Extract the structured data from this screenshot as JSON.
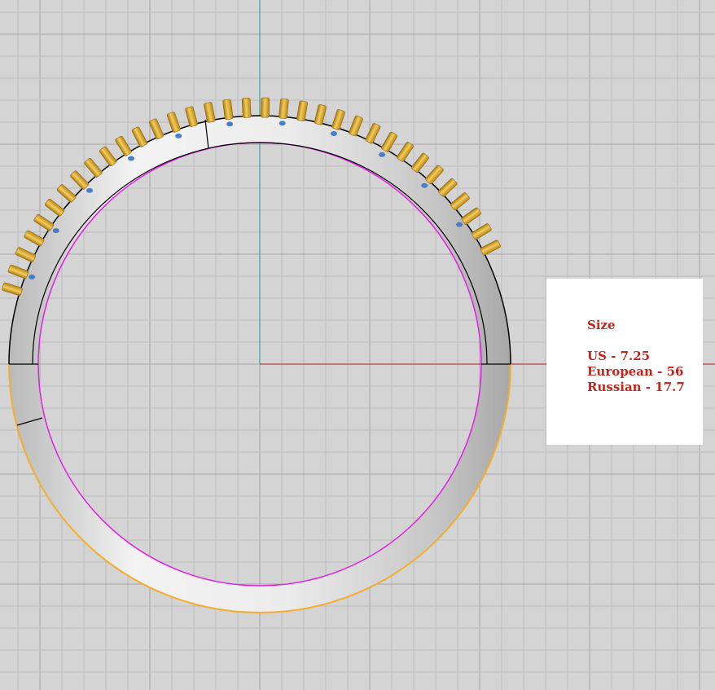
{
  "viewport": {
    "background_color": "#d4d4d4",
    "grid_minor_color": "#bdbdbd",
    "grid_major_color": "#a6a6a6",
    "axis_vertical_color": "#2a9a9a",
    "axis_horizontal_color": "#b11c1c",
    "ring_band_color": "#e4e4e4",
    "ring_outline_color": "#000000",
    "ring_inner_outline_color": "#e020e0",
    "ring_side_outline_color": "#f2ae2e",
    "prong_color": "#d8a52d",
    "stone_color": "#4a7ec4"
  },
  "size_info": {
    "title": "Size",
    "us": "US - 7.25",
    "european": "European - 56",
    "russian": "Russian - 17.7",
    "text_color": "#c4241c"
  }
}
